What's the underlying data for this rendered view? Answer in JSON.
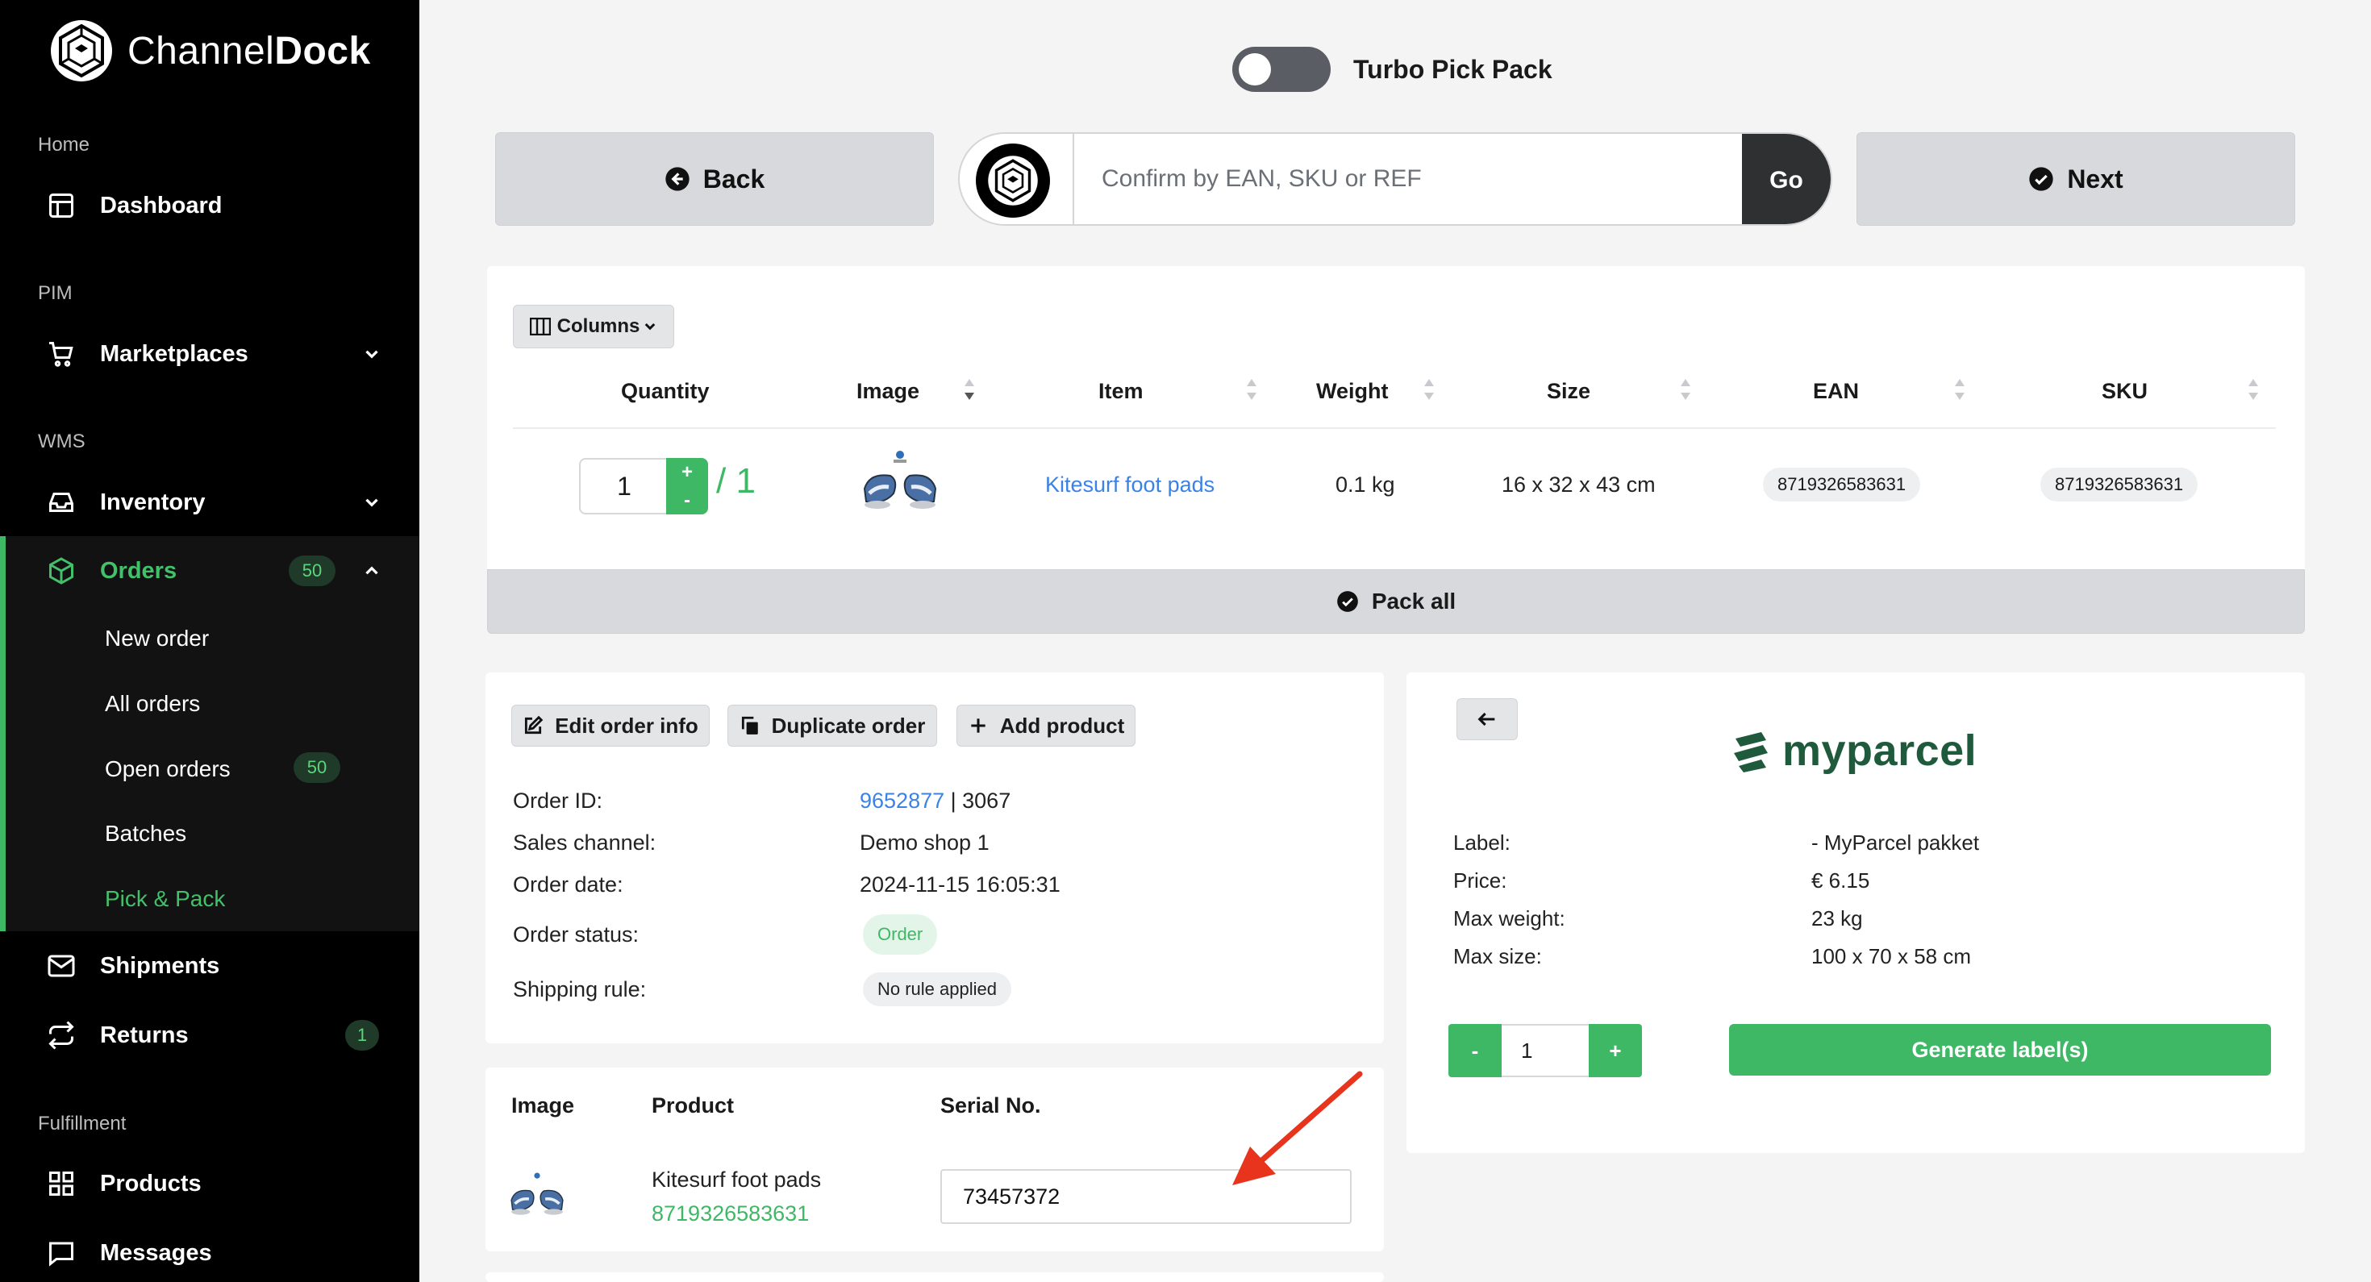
{
  "brand": {
    "name_light": "Channel",
    "name_bold": "Dock"
  },
  "sidebar": {
    "sections": {
      "home": "Home",
      "pim": "PIM",
      "wms": "WMS",
      "fulfillment": "Fulfillment"
    },
    "items": {
      "dashboard": "Dashboard",
      "marketplaces": "Marketplaces",
      "inventory": "Inventory",
      "orders": "Orders",
      "orders_badge": "50",
      "shipments": "Shipments",
      "returns": "Returns",
      "returns_badge": "1",
      "products": "Products",
      "messages": "Messages"
    },
    "orders_sub": {
      "new_order": "New order",
      "all_orders": "All orders",
      "open_orders": "Open orders",
      "open_orders_badge": "50",
      "batches": "Batches",
      "pick_pack": "Pick & Pack"
    }
  },
  "topbar": {
    "toggle_label": "Turbo Pick Pack",
    "back_label": "Back",
    "next_label": "Next",
    "scan_placeholder": "Confirm by EAN, SKU or REF",
    "go_label": "Go"
  },
  "product_table": {
    "columns_label": "Columns",
    "headers": {
      "quantity": "Quantity",
      "image": "Image",
      "item": "Item",
      "weight": "Weight",
      "size": "Size",
      "ean": "EAN",
      "sku": "SKU"
    },
    "row": {
      "quantity": "1",
      "plus": "+",
      "minus": "-",
      "total": "/ 1",
      "item": "Kitesurf foot pads",
      "weight": "0.1 kg",
      "size": "16 x 32 x 43 cm",
      "ean": "8719326583631",
      "sku": "8719326583631"
    },
    "pack_all_label": "Pack all"
  },
  "order_info": {
    "actions": {
      "edit": "Edit order info",
      "duplicate": "Duplicate order",
      "add_product": "Add product"
    },
    "labels": {
      "order_id": "Order ID:",
      "sales_channel": "Sales channel:",
      "order_date": "Order date:",
      "order_status": "Order status:",
      "shipping_rule": "Shipping rule:"
    },
    "values": {
      "order_id_link": "9652877",
      "order_id_rest": " | 3067",
      "sales_channel": "Demo shop 1",
      "order_date": "2024-11-15 16:05:31",
      "order_status": "Order",
      "shipping_rule": "No rule applied"
    }
  },
  "serial_table": {
    "headers": {
      "image": "Image",
      "product": "Product",
      "serial": "Serial No."
    },
    "row": {
      "product": "Kitesurf foot pads",
      "ean": "8719326583631",
      "serial": "73457372"
    }
  },
  "carrier": {
    "name": "myparcel",
    "labels": {
      "label": "Label:",
      "price": "Price:",
      "max_weight": "Max weight:",
      "max_size": "Max size:"
    },
    "values": {
      "label": "- MyParcel pakket",
      "price": "€ 6.15",
      "max_weight": "23 kg",
      "max_size": "100 x 70 x 58 cm"
    },
    "quantity": "1",
    "minus": "-",
    "plus": "+",
    "generate_label": "Generate label(s)"
  },
  "colors": {
    "accent_green": "#3fb866",
    "link_blue": "#3b82e6",
    "sidebar_bg": "#000000",
    "annotation_arrow": "#e8341c",
    "myparcel_green": "#1f5a3c"
  },
  "icons": [
    "channeldock-logo-icon",
    "dashboard-icon",
    "cart-icon",
    "inbox-icon",
    "box-icon",
    "mail-icon",
    "repeat-icon",
    "grid-icon",
    "message-icon",
    "chevron-down-icon",
    "chevron-up-icon",
    "arrow-left-circle-icon",
    "check-circle-icon",
    "columns-icon",
    "edit-icon",
    "copy-icon",
    "plus-icon",
    "arrow-left-icon",
    "myparcel-logo-icon",
    "sort-icon"
  ]
}
